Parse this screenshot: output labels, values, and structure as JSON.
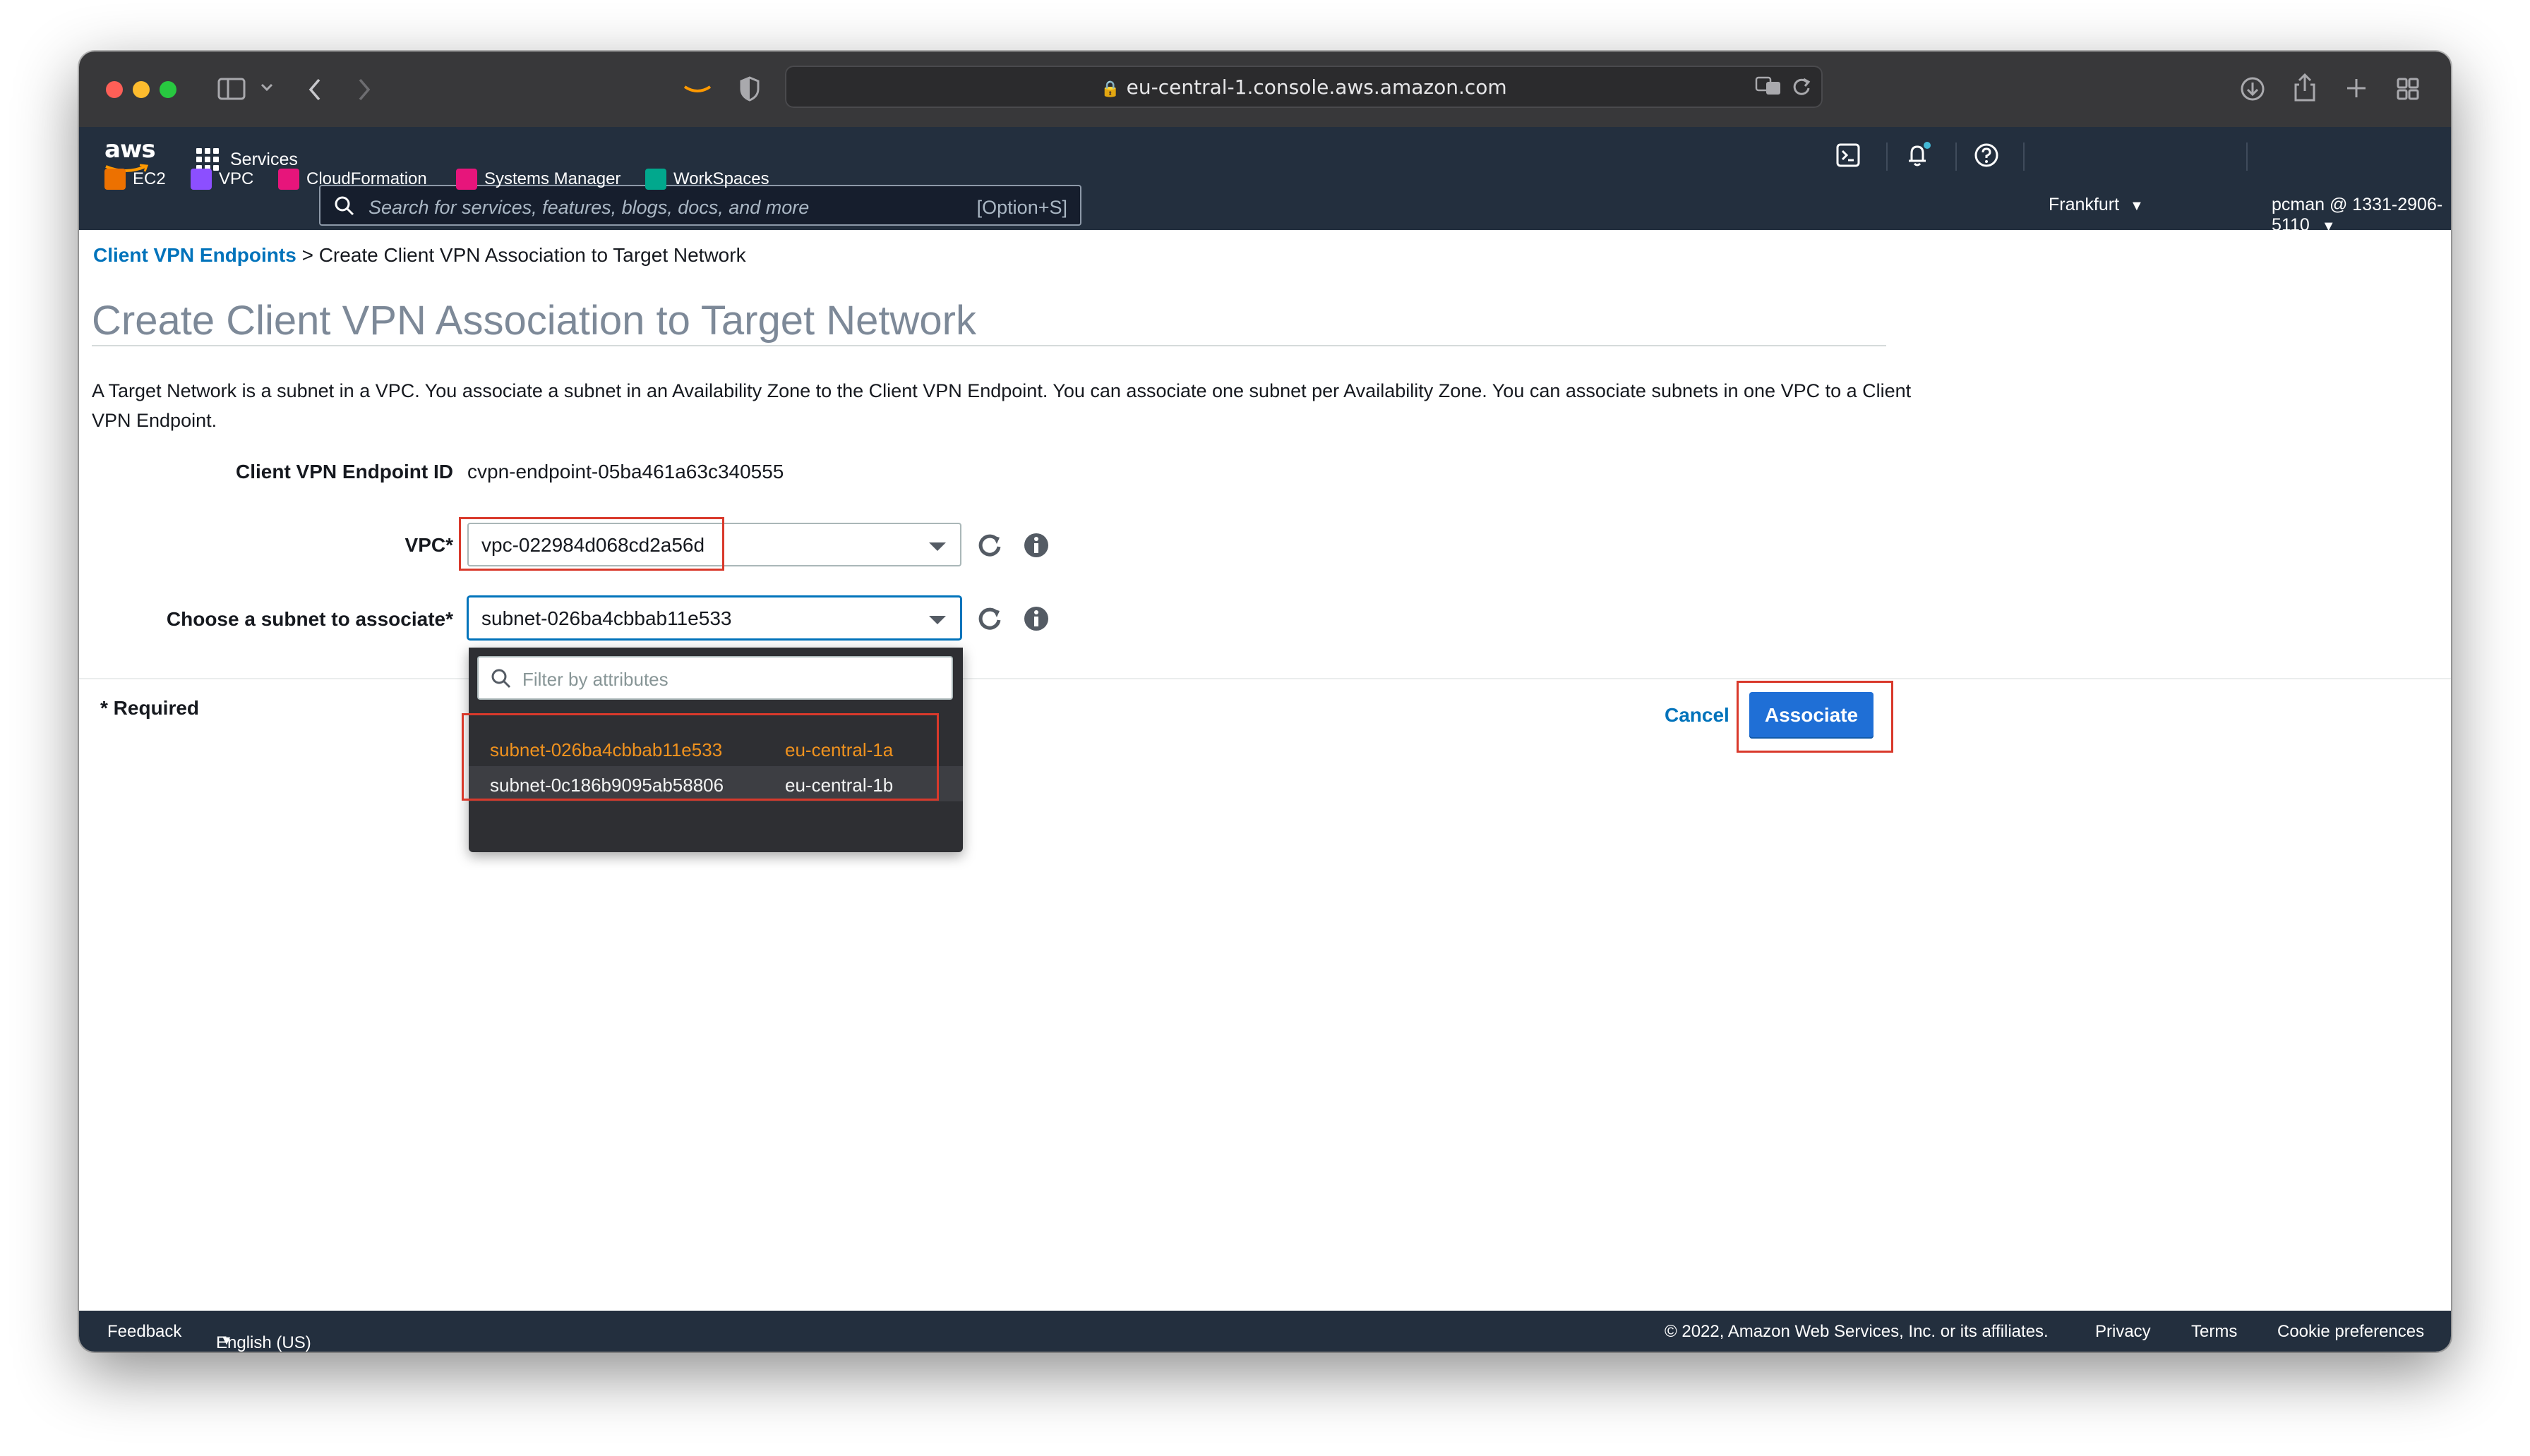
{
  "browser": {
    "url": "eu-central-1.console.aws.amazon.com"
  },
  "header": {
    "logo": "aws",
    "services_label": "Services",
    "search_placeholder": "Search for services, features, blogs, docs, and more",
    "search_shortcut": "[Option+S]",
    "region": "Frankfurt",
    "account": "pcman @ 1331-2906-5110",
    "favorites": [
      {
        "label": "EC2",
        "color": "#ed7100"
      },
      {
        "label": "VPC",
        "color": "#8c4fff"
      },
      {
        "label": "CloudFormation",
        "color": "#e7157b"
      },
      {
        "label": "Systems Manager",
        "color": "#e7157b"
      },
      {
        "label": "WorkSpaces",
        "color": "#01a88d"
      }
    ]
  },
  "breadcrumb": {
    "link": "Client VPN Endpoints",
    "separator": ">",
    "current": "Create Client VPN Association to Target Network"
  },
  "page": {
    "title": "Create Client VPN Association to Target Network",
    "description": "A Target Network is a subnet in a VPC. You associate a subnet in an Availability Zone to the Client VPN Endpoint. You can associate one subnet per Availability Zone. You can associate subnets in one VPC to a Client VPN Endpoint."
  },
  "form": {
    "endpoint_label": "Client VPN Endpoint ID",
    "endpoint_value": "cvpn-endpoint-05ba461a63c340555",
    "vpc_label": "VPC*",
    "vpc_value": "vpc-022984d068cd2a56d",
    "subnet_label": "Choose a subnet to associate*",
    "subnet_value": "subnet-026ba4cbbab11e533",
    "filter_placeholder": "Filter by attributes",
    "subnet_options": [
      {
        "id": "subnet-026ba4cbbab11e533",
        "az": "eu-central-1a",
        "selected": true
      },
      {
        "id": "subnet-0c186b9095ab58806",
        "az": "eu-central-1b",
        "selected": false
      }
    ],
    "required_note": "* Required",
    "cancel_label": "Cancel",
    "associate_label": "Associate"
  },
  "footer": {
    "feedback": "Feedback",
    "language": "English (US)",
    "copyright": "© 2022, Amazon Web Services, Inc. or its affiliates.",
    "privacy": "Privacy",
    "terms": "Terms",
    "cookies": "Cookie preferences"
  }
}
